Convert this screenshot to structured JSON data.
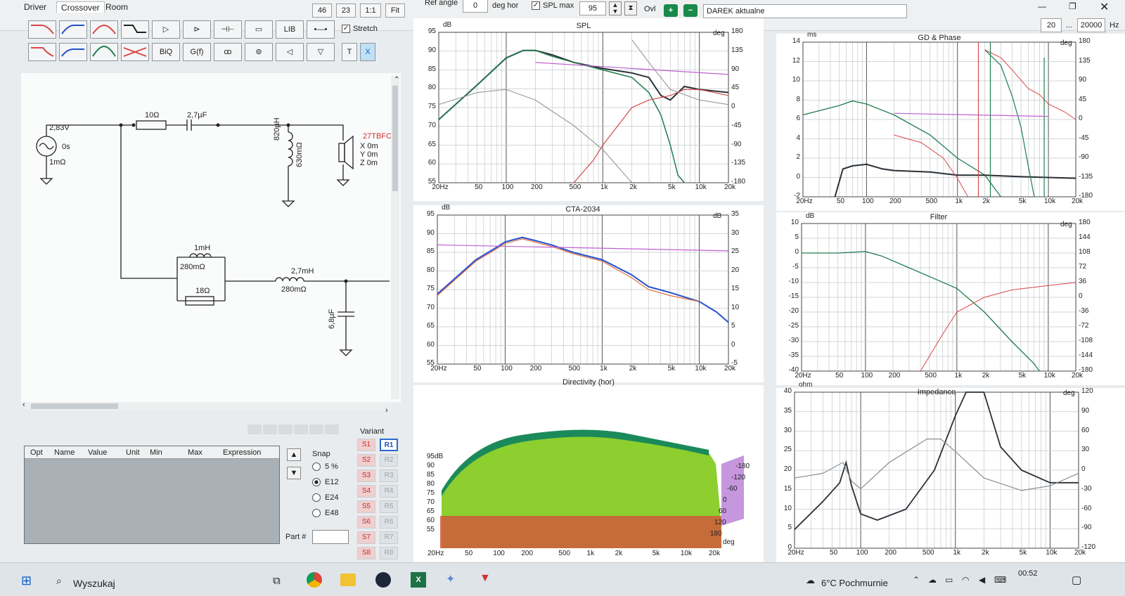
{
  "tabs": [
    "Driver",
    "Crossover",
    "Room"
  ],
  "zoom_buttons": [
    "46",
    "23",
    "1:1",
    "Fit"
  ],
  "ref_angle": {
    "label": "Ref angle",
    "value": "0",
    "unit": "deg hor"
  },
  "spl_max": {
    "label": "SPL max",
    "value": "95",
    "checked": true
  },
  "ovl_label": "Ovl",
  "project_name": "DAREK aktualne",
  "freq_range": {
    "from": "20",
    "sep": "...",
    "to": "20000",
    "unit": "Hz"
  },
  "tools": {
    "lib": "LIB",
    "stretch": "Stretch",
    "biq": "BiQ",
    "gf": "G(f)",
    "t": "T",
    "x": "X"
  },
  "schematic": {
    "source_voltage": "2,83V",
    "source_delay": "0s",
    "source_res": "1mΩ",
    "r1": "10Ω",
    "c1": "2,7µF",
    "l1": "820µH",
    "l1_res": "630mΩ",
    "driver_name": "27TBFC",
    "driver_x": "X 0m",
    "driver_y": "Y 0m",
    "driver_z": "Z 0m",
    "l2": "1mH",
    "l2_res": "280mΩ",
    "r2": "18Ω",
    "l3": "2,7mH",
    "l3_res": "280mΩ",
    "c2": "6,8µF"
  },
  "opt_table": {
    "headers": [
      "Opt",
      "Name",
      "Value",
      "Unit",
      "Min",
      "Max",
      "Expression"
    ],
    "snap_label": "Snap",
    "snap_options": [
      "5 %",
      "E12",
      "E24",
      "E48"
    ],
    "snap_selected": "E12",
    "part_label": "Part #"
  },
  "variant": {
    "label": "Variant",
    "s": [
      "S1",
      "S2",
      "S3",
      "S4",
      "S5",
      "S6",
      "S7",
      "S8"
    ],
    "r": [
      "R1",
      "R2",
      "R3",
      "R4",
      "R5",
      "R6",
      "R7",
      "R8"
    ],
    "active": "R1"
  },
  "charts": {
    "spl": {
      "title": "SPL",
      "yleft_unit": "dB",
      "yright_unit": "deg",
      "yleft": [
        "95",
        "90",
        "85",
        "80",
        "75",
        "70",
        "65",
        "60",
        "55"
      ],
      "yright": [
        "180",
        "135",
        "90",
        "45",
        "0",
        "-45",
        "-90",
        "-135",
        "-180"
      ],
      "x": [
        "20Hz",
        "50",
        "100",
        "200",
        "500",
        "1k",
        "2k",
        "5k",
        "10k",
        "20k"
      ]
    },
    "gd": {
      "title": "GD & Phase",
      "yleft_unit": "ms",
      "yright_unit": "deg",
      "yleft": [
        "14",
        "12",
        "10",
        "8",
        "6",
        "4",
        "2",
        "0",
        "-2"
      ],
      "yright": [
        "180",
        "135",
        "90",
        "45",
        "0",
        "-45",
        "-90",
        "-135",
        "-180"
      ],
      "x": [
        "20Hz",
        "50",
        "100",
        "200",
        "500",
        "1k",
        "2k",
        "5k",
        "10k",
        "20k"
      ]
    },
    "cta": {
      "title": "CTA-2034",
      "yleft_unit": "dB",
      "yright_unit": "dB",
      "yleft": [
        "95",
        "90",
        "85",
        "80",
        "75",
        "70",
        "65",
        "60",
        "55"
      ],
      "yright": [
        "35",
        "30",
        "25",
        "20",
        "15",
        "10",
        "5",
        "0",
        "-5"
      ],
      "x": [
        "20Hz",
        "50",
        "100",
        "200",
        "500",
        "1k",
        "2k",
        "5k",
        "10k",
        "20k"
      ]
    },
    "filter": {
      "title": "Filter",
      "yleft_unit": "dB",
      "yright_unit": "deg",
      "yleft": [
        "10",
        "5",
        "0",
        "-5",
        "-10",
        "-15",
        "-20",
        "-25",
        "-30",
        "-35",
        "-40"
      ],
      "yright": [
        "180",
        "144",
        "108",
        "72",
        "36",
        "0",
        "-36",
        "-72",
        "-108",
        "-144",
        "-180"
      ],
      "x": [
        "20Hz",
        "50",
        "100",
        "200",
        "500",
        "1k",
        "2k",
        "5k",
        "10k",
        "20k"
      ]
    },
    "directivity": {
      "title": "Directivity (hor)",
      "yunit": "dB",
      "y": [
        "95",
        "90",
        "85",
        "80",
        "75",
        "70",
        "65",
        "60",
        "55"
      ],
      "angles": [
        "-180",
        "-120",
        "-60",
        "0",
        "60",
        "120",
        "180"
      ],
      "angle_unit": "deg",
      "x": [
        "20Hz",
        "50",
        "100",
        "200",
        "500",
        "1k",
        "2k",
        "5k",
        "10k",
        "20k"
      ]
    },
    "impedance": {
      "title": "Impedance",
      "yleft_unit": "ohm",
      "yright_unit": "deg",
      "yleft": [
        "40",
        "35",
        "30",
        "25",
        "20",
        "15",
        "10",
        "5",
        "0"
      ],
      "yright": [
        "120",
        "90",
        "60",
        "30",
        "0",
        "-30",
        "-60",
        "-90",
        "-120"
      ],
      "x": [
        "20Hz",
        "50",
        "100",
        "200",
        "500",
        "1k",
        "2k",
        "5k",
        "10k",
        "20k"
      ]
    }
  },
  "taskbar": {
    "search": "Wyszukaj",
    "weather": "6°C  Pochmurnie",
    "time": "00:52"
  },
  "colors": {
    "green": "#1e7d4e",
    "dark": "#2a3036",
    "gray": "#8a8e92",
    "red": "#d84848",
    "magenta": "#c060d0",
    "blue": "#2450d0",
    "orange": "#e07040"
  }
}
